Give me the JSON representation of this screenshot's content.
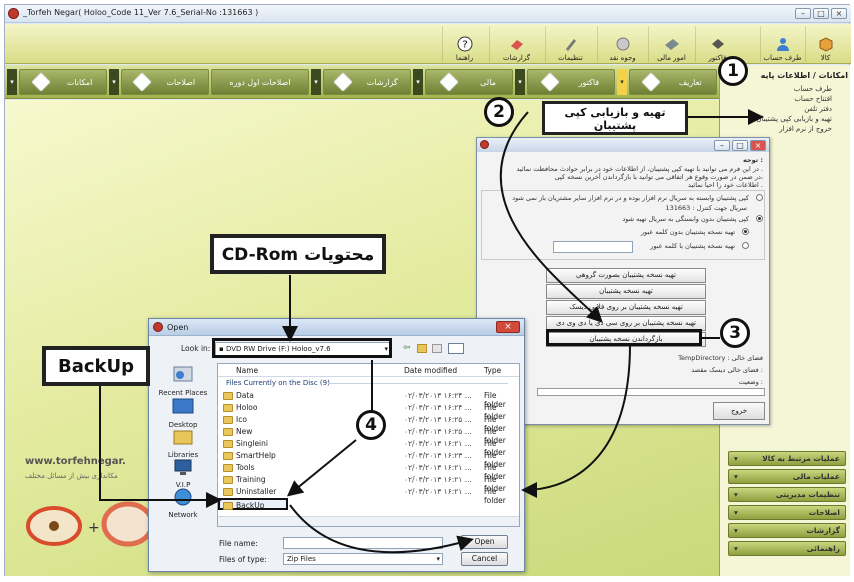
{
  "window": {
    "title": "_Torfeh Negar( Holoo_Code 11_Ver 7.6_Serial-No :131663 )"
  },
  "ribbon": {
    "buttons": [
      {
        "label": "کالا",
        "icon": "box-icon"
      },
      {
        "label": "طرف حساب",
        "icon": "person-icon"
      },
      {
        "label": "فاکتور",
        "icon": "invoice-icon"
      },
      {
        "label": "امور مالی",
        "icon": "money-icon"
      },
      {
        "label": "وجوه نقد",
        "icon": "cash-icon"
      },
      {
        "label": "تنظیمات",
        "icon": "settings-icon"
      },
      {
        "label": "گزارشات",
        "icon": "report-icon"
      },
      {
        "label": "راهنما",
        "icon": "help-icon"
      }
    ]
  },
  "menubar": {
    "items": [
      "تعاریف",
      "فاکتور",
      "مالی",
      "گزارشات",
      "اصلاحات اول دوره",
      "اصلاحات",
      "امکانات"
    ]
  },
  "right_panel": {
    "title": "امکانات / اطلاعات پایه",
    "items": [
      "طرف حساب",
      "افتتاح حساب",
      "دفتر تلفن",
      "تهیه و بازیابی کپی پشتیبان",
      "خروج از نرم افزار"
    ],
    "accordion": [
      "عملیات مرتبط به کالا",
      "عملیات مالی",
      "تنظیمات مدیریتی",
      "اصلاحات",
      "گزارشات",
      "راهنمائی"
    ]
  },
  "backup_dialog": {
    "note_title": "توجه :",
    "note_lines": [
      "در این فرم می توانید با تهیه کپی پشتیبان، از اطلاعات خود در برابر حوادث محافظت نمائید .",
      "در ضمن در صورت وقوع هر اتفاقی می توانید با بازگرداندن آخرین نسخه کپی،",
      "اطلاعات خود را احیا نمائید ."
    ],
    "options": [
      "کپی پشتیبان وابسته به سریال نرم افزار بوده و در نرم افزار سایر مشتریان باز نمی شود",
      "سریال جهت کنترل : 131663",
      "کپی پشتیبان بدون وابستگی به سریال تهیه شود",
      "تهیه نسخه پشتیبان بدون کلمه عبور",
      "تهیه نسخه پشتیبان با کلمه عبور"
    ],
    "buttons": [
      "تهیه نسخه پشتیبان بصورت گروهی",
      "تهیه نسخه پشتیبان",
      "تهیه نسخه پشتیبان بر روی فلاپی دیسک",
      "تهیه نسخه پشتیبان بر روی سی دی یا دی وی دی",
      "بازگرداندن نسخه پشتیبان"
    ],
    "temp_dir_label": "TempDirectory : فضای خالی",
    "dest_label": "فضای خالی دیسک مقصد :",
    "status_label": "وضعیت :",
    "exit_label": "خروج"
  },
  "open_dialog": {
    "title": "Open",
    "look_in_label": "Look in:",
    "look_in_value": "DVD RW Drive (F:) Holoo_v7.6",
    "places": [
      "Recent Places",
      "Desktop",
      "Libraries",
      "V.I.P",
      "Network"
    ],
    "columns": [
      "Name",
      "Date modified",
      "Type"
    ],
    "group_header": "Files Currently on the Disc (9)",
    "files": [
      {
        "name": "Data",
        "date": "۰۲/۰۳/۲۰۱۳ ۱۶:۲۴ ...",
        "type": "File folder"
      },
      {
        "name": "Holoo",
        "date": "۰۲/۰۳/۲۰۱۳ ۱۶:۲۴ ...",
        "type": "File folder"
      },
      {
        "name": "Ico",
        "date": "۰۲/۰۳/۲۰۱۳ ۱۶:۲۵ ...",
        "type": "File folder"
      },
      {
        "name": "New",
        "date": "۰۲/۰۳/۲۰۱۳ ۱۶:۲۵ ...",
        "type": "File folder"
      },
      {
        "name": "Singleini",
        "date": "۰۲/۰۳/۲۰۱۳ ۱۶:۲۱ ...",
        "type": "File folder"
      },
      {
        "name": "SmartHelp",
        "date": "۰۲/۰۳/۲۰۱۳ ۱۶:۲۳ ...",
        "type": "File folder"
      },
      {
        "name": "Tools",
        "date": "۰۲/۰۳/۲۰۱۳ ۱۶:۲۱ ...",
        "type": "File folder"
      },
      {
        "name": "Training",
        "date": "۰۲/۰۳/۲۰۱۳ ۱۶:۲۱ ...",
        "type": "File folder"
      },
      {
        "name": "Uninstaller",
        "date": "۰۲/۰۳/۲۰۱۳ ۱۶:۲۱ ...",
        "type": "File folder"
      },
      {
        "name": "BackUp",
        "date": "۰۲/۰۳/۲۰۱۳ ۱۶:۲۱ ...",
        "type": "File folder"
      }
    ],
    "file_name_label": "File name:",
    "file_name_value": "",
    "files_of_type_label": "Files of type:",
    "files_of_type_value": "Zip Files",
    "open_button": "Open",
    "cancel_button": "Cancel"
  },
  "annotations": {
    "n1": "1",
    "n2": "2",
    "n3": "3",
    "n4": "4",
    "callout_backup_title": "تهیه و بازیابی کپی پشتیبان",
    "callout_cdrom": "CD-Rom محتویات",
    "callout_backup_folder": "BackUp"
  },
  "background": {
    "website": "www.torfehnegar.",
    "tagline": "مکانداری بیش از مسائل مختلف"
  }
}
